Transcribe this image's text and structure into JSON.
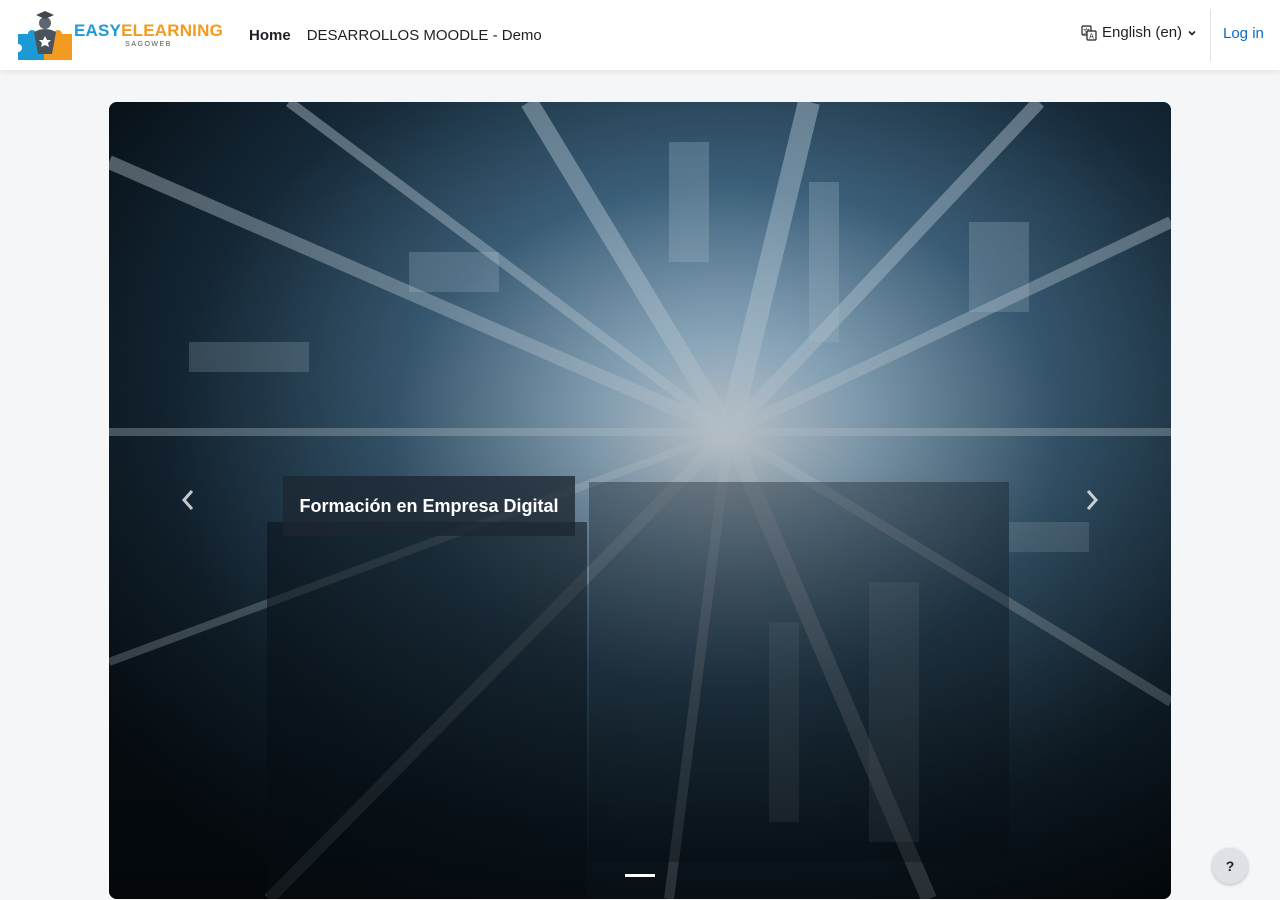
{
  "site": {
    "logo_word_1": "EASY",
    "logo_word_2": "ELEARNING",
    "logo_sub": "SAGOWEB",
    "colors": {
      "logo_blue": "#1c9ad6",
      "logo_orange": "#f39a21",
      "link": "#0f6cbf"
    }
  },
  "nav": {
    "items": [
      {
        "label": "Home",
        "active": true
      },
      {
        "label": "DESARROLLOS MOODLE - Demo",
        "active": false
      }
    ],
    "language": {
      "label": "English (en)",
      "icon": "language-icon"
    },
    "login_label": "Log in"
  },
  "carousel": {
    "slides": [
      {
        "caption": "Formación en Empresa Digital",
        "active": true
      }
    ],
    "prev_icon": "chevron-left-icon",
    "next_icon": "chevron-right-icon"
  },
  "help": {
    "label": "?"
  }
}
